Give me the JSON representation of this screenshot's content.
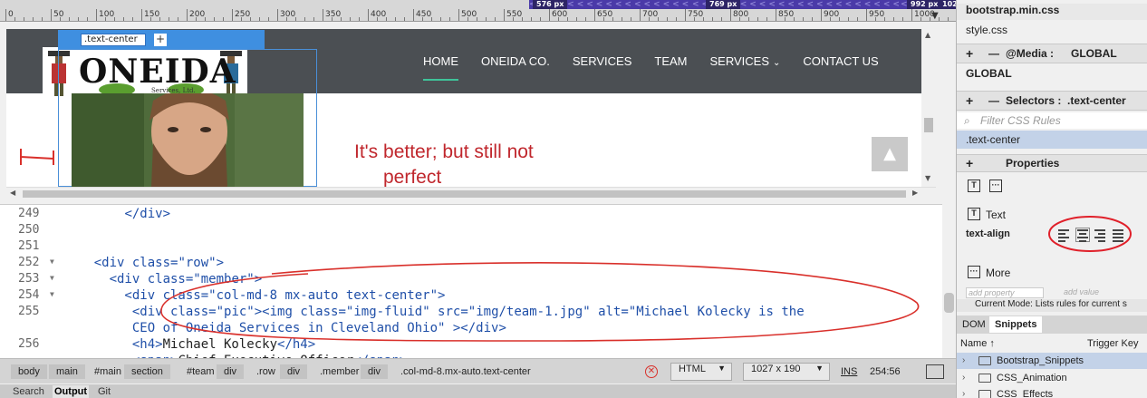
{
  "ruler": {
    "ticks": [
      "0",
      "50",
      "100",
      "150",
      "200",
      "250",
      "300",
      "350",
      "400",
      "450",
      "500",
      "550",
      "600",
      "650",
      "700",
      "750",
      "800",
      "850",
      "900",
      "950",
      "1000"
    ],
    "media_queries": [
      {
        "label": "576",
        "unit": "px"
      },
      {
        "label": "769",
        "unit": "px"
      },
      {
        "label": "992",
        "unit": "px"
      },
      {
        "label": "102",
        "unit": ""
      }
    ]
  },
  "liveview": {
    "selected_tag": ".text-center",
    "add_label": "+",
    "logo_text": "ONEIDA",
    "logo_sub": "Services, Ltd.",
    "nav": [
      "HOME",
      "ONEIDA CO.",
      "SERVICES",
      "TEAM",
      "SERVICES",
      "CONTACT US"
    ],
    "heading": "It's better; but still not",
    "heading_cont": "perfect",
    "back_to_top": "▲"
  },
  "code": {
    "lines": [
      {
        "num": "249",
        "fold": "",
        "segments": [
          {
            "t": "        ",
            "c": "txt"
          },
          {
            "t": "</div>",
            "c": "tag"
          }
        ]
      },
      {
        "num": "250",
        "fold": "",
        "segments": []
      },
      {
        "num": "251",
        "fold": "",
        "segments": []
      },
      {
        "num": "252",
        "fold": "▼",
        "segments": [
          {
            "t": "    <div ",
            "c": "tag"
          },
          {
            "t": "class=",
            "c": "attr"
          },
          {
            "t": "\"row\"",
            "c": "val"
          },
          {
            "t": ">",
            "c": "tag"
          }
        ]
      },
      {
        "num": "253",
        "fold": "▼",
        "segments": [
          {
            "t": "      <div ",
            "c": "tag"
          },
          {
            "t": "class=",
            "c": "attr"
          },
          {
            "t": "\"member\"",
            "c": "val"
          },
          {
            "t": ">",
            "c": "tag"
          }
        ]
      },
      {
        "num": "254",
        "fold": "▼",
        "segments": [
          {
            "t": "        <div ",
            "c": "tag"
          },
          {
            "t": "class=",
            "c": "attr"
          },
          {
            "t": "\"col-md-8 mx-auto text-center\"",
            "c": "val"
          },
          {
            "t": ">",
            "c": "tag"
          }
        ]
      },
      {
        "num": "255",
        "fold": "",
        "segments": [
          {
            "t": "         <div ",
            "c": "tag"
          },
          {
            "t": "class=",
            "c": "attr"
          },
          {
            "t": "\"pic\"",
            "c": "val"
          },
          {
            "t": "><img ",
            "c": "tag"
          },
          {
            "t": "class=",
            "c": "attr"
          },
          {
            "t": "\"img-fluid\"",
            "c": "val"
          },
          {
            "t": " src=",
            "c": "attr"
          },
          {
            "t": "\"img/team-1.jpg\"",
            "c": "val"
          },
          {
            "t": " alt=",
            "c": "attr"
          },
          {
            "t": "\"Michael Kolecky is the",
            "c": "val"
          }
        ]
      },
      {
        "num": "",
        "fold": "",
        "segments": [
          {
            "t": "         CEO of Oneida Services in Cleveland Ohio\"",
            "c": "val"
          },
          {
            "t": " ></div>",
            "c": "tag"
          }
        ]
      },
      {
        "num": "256",
        "fold": "",
        "segments": [
          {
            "t": "         <h4>",
            "c": "tag"
          },
          {
            "t": "Michael Kolecky",
            "c": "txt"
          },
          {
            "t": "</h4>",
            "c": "tag"
          }
        ]
      },
      {
        "num": "",
        "fold": "",
        "segments": [
          {
            "t": "         <span>",
            "c": "tag"
          },
          {
            "t": "Chief Executive Officer",
            "c": "txt"
          },
          {
            "t": "</span>",
            "c": "tag"
          }
        ]
      }
    ]
  },
  "statusbar": {
    "breadcrumbs": [
      "body",
      "main",
      "#main",
      "section",
      "#team",
      "div",
      ".row",
      "div",
      ".member",
      "div",
      ".col-md-8.mx-auto.text-center"
    ],
    "language": "HTML",
    "window_size": "1027 x 190",
    "ins": "INS",
    "cursor": "254:56"
  },
  "bottom_tabs": [
    "Search",
    "Output",
    "Git"
  ],
  "right_panel": {
    "sources": [
      "bootstrap.min.css",
      "style.css"
    ],
    "media_label": "@Media :",
    "media_value": "GLOBAL",
    "global": "GLOBAL",
    "selectors_label": "Selectors :",
    "selectors_value": ".text-center",
    "filter_placeholder": "Filter CSS Rules",
    "selected_rule": ".text-center",
    "properties_label": "Properties",
    "text_section": "Text",
    "text_align_label": "text-align",
    "more_label": "More",
    "add_property": "add property",
    "add_value": "add value",
    "current_mode": "Current Mode: Lists rules for current s",
    "tabs": [
      "DOM",
      "Snippets"
    ],
    "snippet_headers": {
      "name": "Name",
      "trigger": "Trigger Key"
    },
    "snippets": [
      "Bootstrap_Snippets",
      "CSS_Animation",
      "CSS_Effects"
    ]
  }
}
